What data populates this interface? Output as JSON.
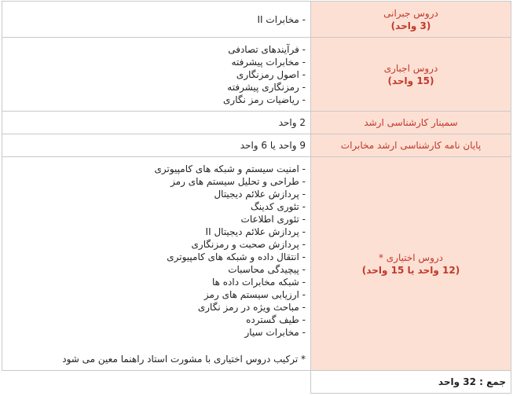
{
  "rows": [
    {
      "label": "دروس جبرانی",
      "units": "(3 واحد)",
      "items": [
        "مخابرات II"
      ]
    },
    {
      "label": "دروس اجباری",
      "units": "(15 واحد)",
      "items": [
        "فرآیندهای تصادفی",
        "مخابرات پیشرفته",
        "اصول رمزنگاری",
        "رمزنگاری پیشرفته",
        "ریاضیات رمز نگاری"
      ]
    },
    {
      "label": "سمینار کارشناسی ارشد",
      "value": "2 واحد"
    },
    {
      "label": "پایان نامه کارشناسی ارشد مخابرات",
      "value": "9 واحد یا 6 واحد"
    },
    {
      "label": "دروس اختیاری *",
      "units": "(12 واحد یا 15 واحد)",
      "items": [
        "امنیت سیستم و شبکه های کامپیوتری",
        "طراحی و تحلیل سیستم های رمز",
        "پردازش علائم دیجیتال",
        "تئوری کدینگ",
        "تئوری اطلاعات",
        "پردازش علائم دیجیتال II",
        "پردازش صحبت و رمزنگاری",
        "انتقال داده و شبکه های کامپیوتری",
        "پیچیدگی محاسبات",
        "شبکه مخابرات داده ها",
        "ارزیابی سیستم های رمز",
        "مباحث ویژه در رمز نگاری",
        "طیف گسترده",
        "مخابرات سیار"
      ],
      "note": "* ترکیب دروس اختیاری با مشورت استاد راهنما معین می شود"
    }
  ],
  "total": "جمع :  32 واحد"
}
